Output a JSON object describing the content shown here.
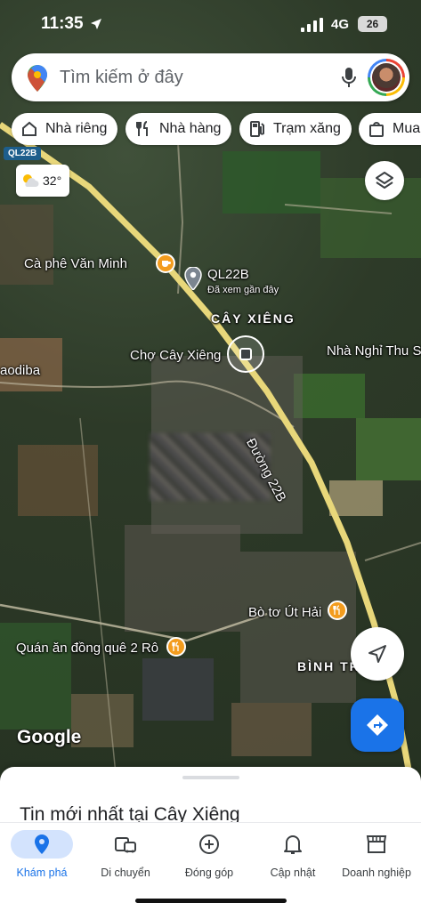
{
  "status_bar": {
    "time": "11:35",
    "network": "4G",
    "battery": "26"
  },
  "search": {
    "placeholder": "Tìm kiếm ở đây"
  },
  "chips": [
    {
      "label": "Nhà riêng",
      "icon": "home-icon"
    },
    {
      "label": "Nhà hàng",
      "icon": "restaurant-icon"
    },
    {
      "label": "Trạm xăng",
      "icon": "gas-station-icon"
    },
    {
      "label": "Mua",
      "icon": "shopping-bag-icon"
    }
  ],
  "weather": {
    "temperature": "32°"
  },
  "map": {
    "road_badge": "QL22B",
    "labels": {
      "cafe": "Cà phê Văn Minh",
      "ql22b": "QL22B",
      "recent": "Đã xem gần đây",
      "area": "CÂY XIÊNG",
      "market": "Chợ Cây Xiêng",
      "motel": "Nhà Nghỉ Thu Sư",
      "left_edge": "aodiba",
      "street": "Đường 22B",
      "bo_to": "Bò tơ Út Hải",
      "quan_an": "Quán ăn đồng quê 2 Rô",
      "binh_tr": "BÌNH TR"
    },
    "google_watermark": "Google"
  },
  "sheet": {
    "title": "Tin mới nhất tại Cây Xiêng"
  },
  "nav": [
    {
      "label": "Khám phá",
      "icon": "explore-pin-icon",
      "active": true
    },
    {
      "label": "Di chuyển",
      "icon": "commute-icon",
      "active": false
    },
    {
      "label": "Đóng góp",
      "icon": "contribute-plus-icon",
      "active": false
    },
    {
      "label": "Cập nhật",
      "icon": "bell-icon",
      "active": false
    },
    {
      "label": "Doanh nghiệp",
      "icon": "store-icon",
      "active": false
    }
  ],
  "colors": {
    "accent": "#1a73e8",
    "pin_orange": "#f39c1e",
    "road": "#e8d77a"
  }
}
